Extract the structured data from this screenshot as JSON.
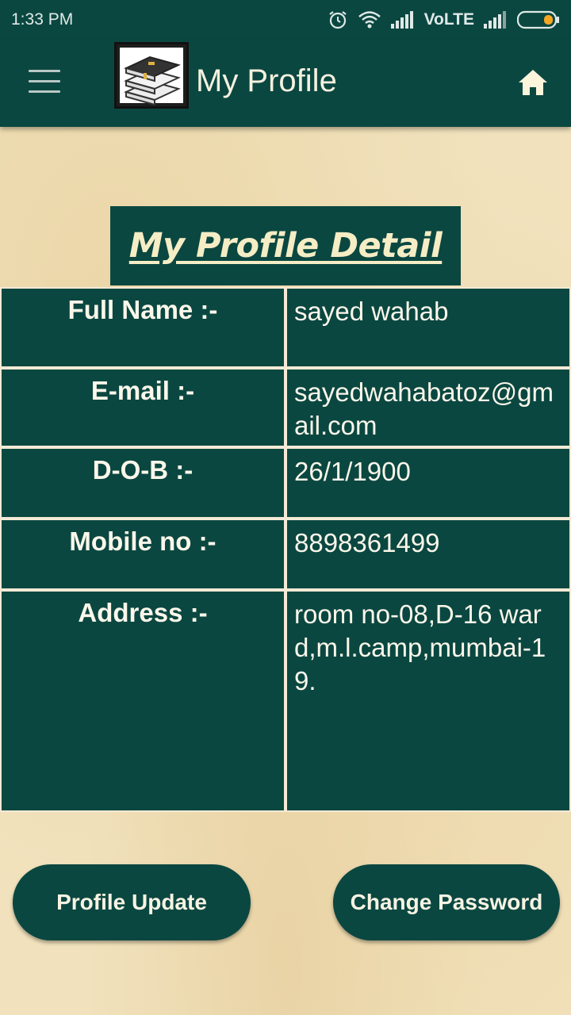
{
  "status_bar": {
    "time": "1:33 PM",
    "network_label": "VoLTE",
    "icons": [
      "alarm-icon",
      "wifi-icon",
      "signal-icon",
      "signal-icon",
      "battery-icon"
    ]
  },
  "app_bar": {
    "title": "My Profile",
    "menu_icon": "hamburger-menu-icon",
    "logo_icon": "books-logo",
    "home_icon": "home-icon"
  },
  "profile": {
    "heading": "My Profile Detail",
    "rows": [
      {
        "label": "Full Name :-",
        "value": "sayed wahab"
      },
      {
        "label": "E-mail :-",
        "value": "sayedwahabatoz@gmail.com"
      },
      {
        "label": "D-O-B :-",
        "value": "26/1/1900"
      },
      {
        "label": "Mobile no :-",
        "value": "8898361499"
      },
      {
        "label": "Address :-",
        "value": "room no-08,D-16 ward,m.l.camp,mumbai-19."
      }
    ]
  },
  "actions": {
    "profile_update": "Profile Update",
    "change_password": "Change Password"
  },
  "colors": {
    "primary": "#0b4741",
    "background": "#f1e2bd",
    "heading_text": "#f5edc5",
    "battery_accent": "#f5a623"
  }
}
